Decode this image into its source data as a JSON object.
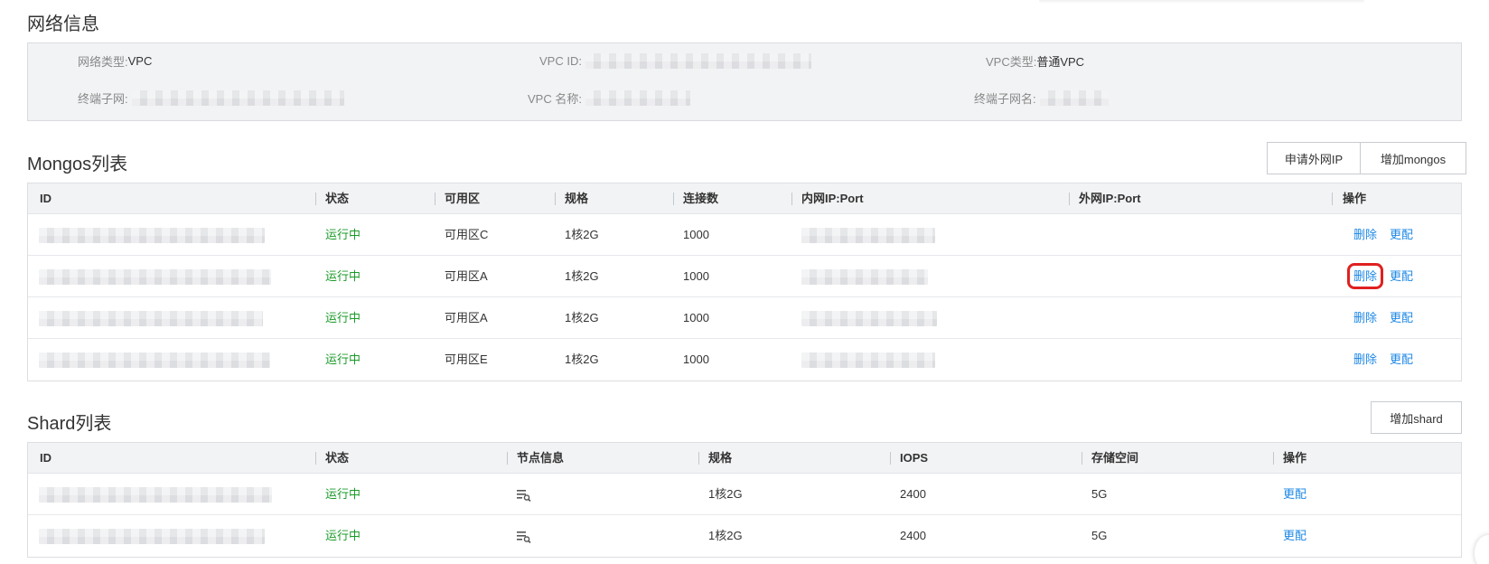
{
  "network": {
    "title": "网络信息",
    "network_type_label": "网络类型:",
    "network_type_value": "VPC",
    "vpc_id_label": "VPC ID:",
    "vpc_type_label": "VPC类型:",
    "vpc_type_value": "普通VPC",
    "terminal_subnet_label": "终端子网:",
    "vpc_name_label": "VPC 名称:",
    "terminal_subnet_name_label": "终端子网名:"
  },
  "mongos": {
    "title": "Mongos列表",
    "buttons": {
      "apply_public_ip": "申请外网IP",
      "add_mongos": "增加mongos"
    },
    "columns": [
      "ID",
      "状态",
      "可用区",
      "规格",
      "连接数",
      "内网IP:Port",
      "外网IP:Port",
      "操作"
    ],
    "rows": [
      {
        "status": "运行中",
        "zone": "可用区C",
        "spec": "1核2G",
        "connections": "1000",
        "public_ip": "",
        "action_delete": "删除",
        "action_change": "更配"
      },
      {
        "status": "运行中",
        "zone": "可用区A",
        "spec": "1核2G",
        "connections": "1000",
        "public_ip": "",
        "action_delete": "删除",
        "action_change": "更配"
      },
      {
        "status": "运行中",
        "zone": "可用区A",
        "spec": "1核2G",
        "connections": "1000",
        "public_ip": "",
        "action_delete": "删除",
        "action_change": "更配"
      },
      {
        "status": "运行中",
        "zone": "可用区E",
        "spec": "1核2G",
        "connections": "1000",
        "public_ip": "",
        "action_delete": "删除",
        "action_change": "更配"
      }
    ]
  },
  "shard": {
    "title": "Shard列表",
    "buttons": {
      "add_shard": "增加shard"
    },
    "columns": [
      "ID",
      "状态",
      "节点信息",
      "规格",
      "IOPS",
      "存储空间",
      "操作"
    ],
    "rows": [
      {
        "status": "运行中",
        "node_icon": "list-search-icon",
        "spec": "1核2G",
        "iops": "2400",
        "storage": "5G",
        "action_change": "更配"
      },
      {
        "status": "运行中",
        "node_icon": "list-search-icon",
        "spec": "1核2G",
        "iops": "2400",
        "storage": "5G",
        "action_change": "更配"
      }
    ]
  },
  "colors": {
    "status_running": "#1a9a28",
    "link": "#1e88e5",
    "highlight": "#e02020",
    "panel_bg": "#f2f3f5"
  }
}
